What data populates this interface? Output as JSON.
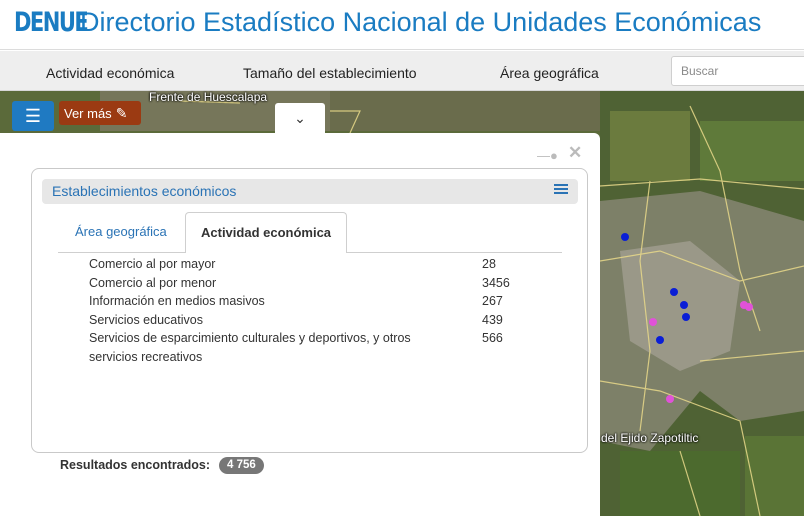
{
  "header": {
    "logo_text": "DENUE",
    "title": "Directorio Estadístico Nacional de Unidades Económicas"
  },
  "menubar": {
    "items": [
      {
        "label": "Actividad económica"
      },
      {
        "label": "Tamaño del establecimiento"
      },
      {
        "label": "Área geográfica"
      }
    ],
    "search_placeholder": "Buscar"
  },
  "map": {
    "labels": [
      "Frente de Huescalapa",
      "del Ejido Zapotiltic"
    ],
    "ver_mas_label": "Ver más",
    "marker_colors": {
      "blue": "#0a1ed6",
      "magenta": "#e052d8"
    }
  },
  "panel": {
    "title": "Establecimientos económicos",
    "tabs": [
      {
        "label": "Área geográfica",
        "active": false
      },
      {
        "label": "Actividad económica",
        "active": true
      }
    ],
    "rows": [
      {
        "name": "Comercio al por mayor",
        "count": "28"
      },
      {
        "name": "Comercio al por menor",
        "count": "3456"
      },
      {
        "name": "Información en medios masivos",
        "count": "267"
      },
      {
        "name": "Servicios educativos",
        "count": "439"
      },
      {
        "name": "Servicios de esparcimiento culturales y deportivos, y otros servicios recreativos",
        "count": "566"
      }
    ],
    "results_label": "Resultados encontrados:",
    "results_count": "4 756"
  },
  "colors": {
    "accent": "#1a7cc2",
    "ver_mas": "#9b3a12",
    "badge": "#777777"
  }
}
